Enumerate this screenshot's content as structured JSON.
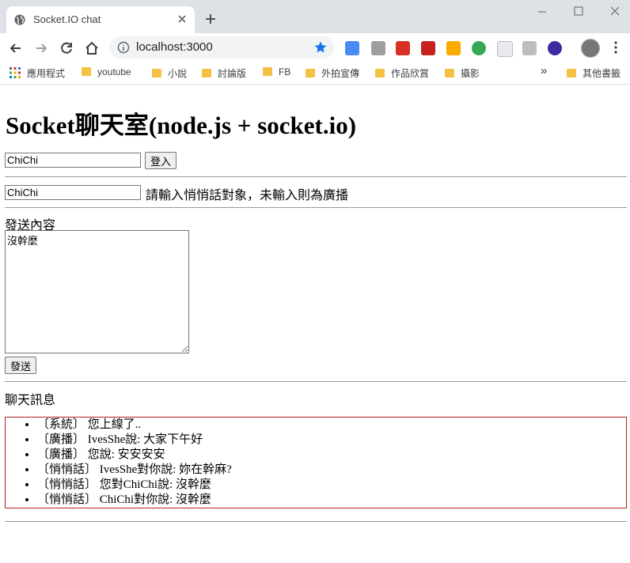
{
  "browser": {
    "tab_title": "Socket.IO chat",
    "url": "localhost:3000",
    "bookmarks": {
      "apps": "應用程式",
      "items": [
        "youtube",
        "小說",
        "討論版",
        "FB",
        "外拍宣傳",
        "作品欣賞",
        "攝影"
      ],
      "overflow": "»",
      "other": "其他書籤"
    }
  },
  "page": {
    "title": "Socket聊天室(node.js + socket.io)",
    "login": {
      "name_value": "ChiChi",
      "button": "登入"
    },
    "whisper": {
      "target_value": "ChiChi",
      "hint": "請輸入悄悄話對象，未輸入則為廣播"
    },
    "message": {
      "label": "發送內容",
      "value": "沒幹麼",
      "send_button": "發送"
    },
    "chat": {
      "label": "聊天訊息",
      "messages": [
        "〔系統〕 您上線了..",
        "〔廣播〕 IvesShe說: 大家下午好",
        "〔廣播〕 您說: 安安安安",
        "〔悄悄話〕 IvesShe對你說: 妳在幹麻?",
        "〔悄悄話〕 您對ChiChi說: 沒幹麼",
        "〔悄悄話〕 ChiChi對你說: 沒幹麼"
      ]
    }
  },
  "colors": {
    "chat_border": "#b22222",
    "bookmark_folder": "#f6c142",
    "star": "#1a73e8"
  }
}
